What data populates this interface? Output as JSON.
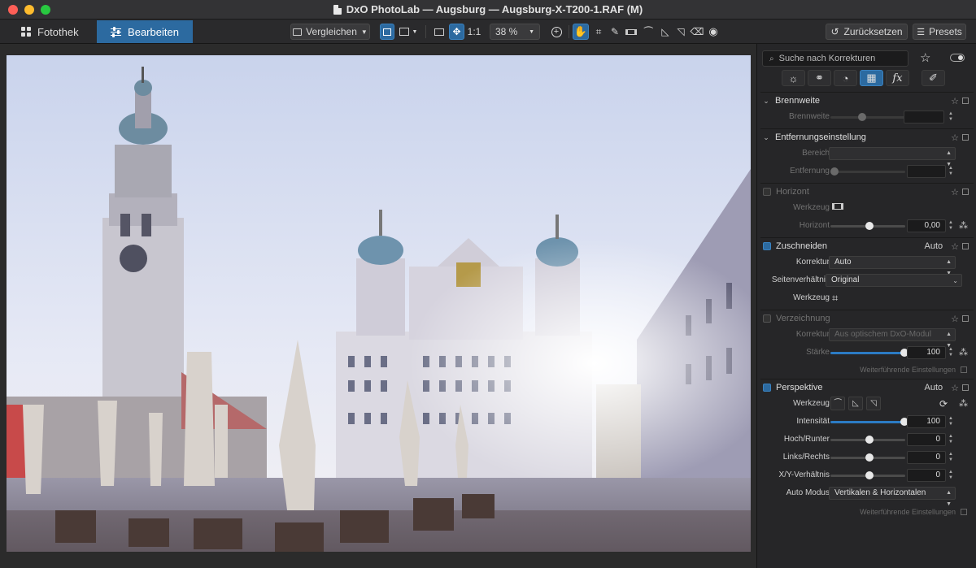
{
  "window": {
    "title": "DxO PhotoLab — Augsburg — Augsburg-X-T200-1.RAF (M)"
  },
  "toolbar": {
    "tab_fotothek": "Fotothek",
    "tab_bearbeiten": "Bearbeiten",
    "compare_label": "Vergleichen",
    "ratio_label": "1:1",
    "zoom_value": "38 %",
    "reset_label": "Zurücksetzen",
    "presets_label": "Presets"
  },
  "panel": {
    "search_placeholder": "Suche nach Korrekturen",
    "sections": {
      "brennweite": {
        "title": "Brennweite",
        "row_label": "Brennweite"
      },
      "entfernung": {
        "title": "Entfernungseinstellung",
        "bereich_label": "Bereich",
        "entfernung_label": "Entfernung"
      },
      "horizont": {
        "title": "Horizont",
        "werkzeug_label": "Werkzeug",
        "horizont_label": "Horizont",
        "horizont_value": "0,00"
      },
      "zuschneiden": {
        "title": "Zuschneiden",
        "auto_label": "Auto",
        "korrektur_label": "Korrektur",
        "korrektur_value": "Auto",
        "seiten_label": "Seitenverhältnis",
        "seiten_value": "Original",
        "werkzeug_label": "Werkzeug"
      },
      "verzeichnung": {
        "title": "Verzeichnung",
        "korrektur_label": "Korrektur",
        "korrektur_value": "Aus optischem DxO-Modul",
        "staerke_label": "Stärke",
        "staerke_value": "100",
        "more_label": "Weiterführende Einstellungen"
      },
      "perspektive": {
        "title": "Perspektive",
        "auto_label": "Auto",
        "werkzeug_label": "Werkzeug",
        "intensitaet_label": "Intensität",
        "intensitaet_value": "100",
        "hoch_label": "Hoch/Runter",
        "hoch_value": "0",
        "links_label": "Links/Rechts",
        "links_value": "0",
        "xy_label": "X/Y-Verhältnis",
        "xy_value": "0",
        "automodus_label": "Auto Modus",
        "automodus_value": "Vertikalen & Horizontalen",
        "more_label": "Weiterführende Einstellungen"
      }
    }
  },
  "colors": {
    "accent": "#2c6aa0",
    "panel_bg": "#262628"
  },
  "icons": [
    "grid-icon",
    "sliders-icon",
    "compare-icon",
    "zoom-in-icon",
    "hand-icon",
    "crop-icon",
    "eyedropper-icon",
    "horizon-icon",
    "perspective-icon",
    "eraser-icon",
    "eye-icon",
    "reset-icon",
    "star-icon",
    "toggle-icon",
    "magic-wand-icon"
  ]
}
